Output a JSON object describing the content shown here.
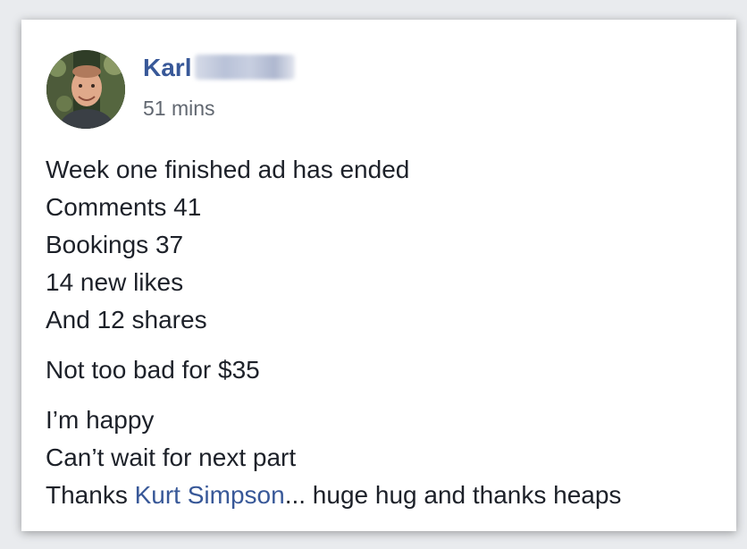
{
  "post": {
    "author": {
      "name": "Karl"
    },
    "timestamp": "51 mins",
    "paragraphs": [
      {
        "lines": [
          "Week one finished ad has ended",
          "Comments 41",
          "Bookings 37",
          "14 new likes",
          "And 12 shares"
        ]
      },
      {
        "lines": [
          "Not too bad for $35"
        ]
      },
      {
        "lines": [
          "I’m happy",
          "Can’t wait for next part"
        ],
        "thanks": {
          "prefix": "Thanks ",
          "mention": "Kurt Simpson",
          "suffix": "... huge hug and thanks heaps"
        }
      }
    ]
  },
  "colors": {
    "link": "#385898",
    "text": "#1d2129",
    "muted": "#616770",
    "background": "#e9ebee"
  }
}
